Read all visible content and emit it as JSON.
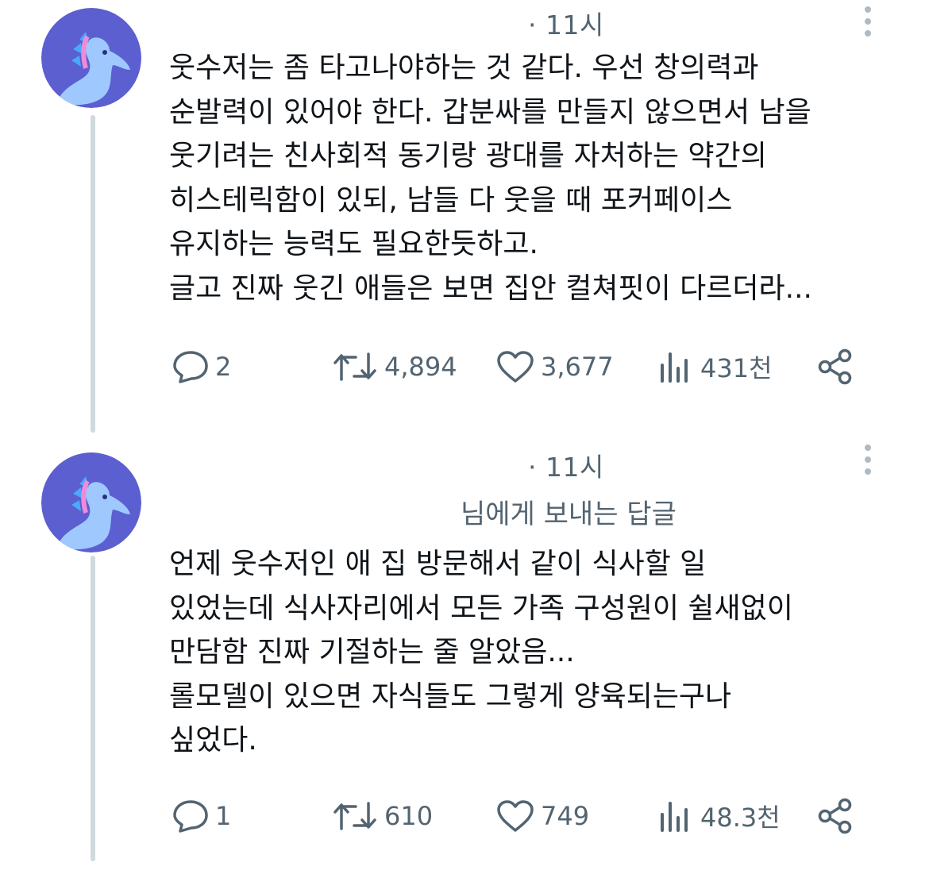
{
  "posts": [
    {
      "time": "· 11시",
      "reply_to": "",
      "lines": [
        "웃수저는 좀 타고나야하는 것 같다. 우선 창의력과",
        "순발력이 있어야 한다. 갑분싸를 만들지 않으면서 남을",
        "웃기려는 친사회적 동기랑 광대를 자처하는 약간의",
        "히스테릭함이 있되, 남들 다 웃을 때 포커페이스",
        "유지하는 능력도 필요한듯하고.",
        "글고 진짜 웃긴 애들은 보면 집안 컬쳐핏이 다르더라..."
      ],
      "stats": {
        "replies": "2",
        "retweets": "4,894",
        "likes": "3,677",
        "views": "431천"
      }
    },
    {
      "time": "· 11시",
      "reply_to": "님에게 보내는 답글",
      "lines": [
        "언제 웃수저인 애 집 방문해서 같이 식사할 일",
        "있었는데 식사자리에서 모든 가족 구성원이 쉴새없이",
        "만담함 진짜 기절하는 줄 알았음...",
        "롤모델이 있으면 자식들도 그렇게 양육되는구나",
        "싶었다."
      ],
      "stats": {
        "replies": "1",
        "retweets": "610",
        "likes": "749",
        "views": "48.3천"
      }
    }
  ],
  "icons": {
    "reply": "reply-bubble-icon",
    "retweet": "retweet-icon",
    "like": "heart-icon",
    "views": "views-bar-chart-icon",
    "share": "share-icon",
    "more": "more-options-icon",
    "avatar": "seahorse-avatar"
  },
  "colors": {
    "text": "#0f1419",
    "muted": "#536471",
    "thread_line": "#cfd9de",
    "avatar_bg": "#5b5fcf"
  }
}
